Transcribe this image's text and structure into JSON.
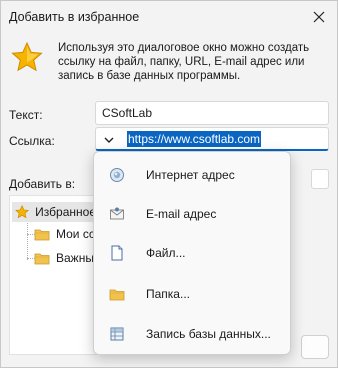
{
  "window": {
    "title": "Добавить в избранное"
  },
  "intro": {
    "text": "Используя это диалоговое окно можно создать ссылку на файл, папку, URL, E-mail адрес или запись в базе данных программы."
  },
  "form": {
    "text_label": "Текст:",
    "text_value": "CSoftLab",
    "link_label": "Ссылка:",
    "link_value": "https://www.csoftlab.com",
    "addto_label": "Добавить в:"
  },
  "tree": {
    "items": [
      {
        "label": "Избранное",
        "icon": "star-icon"
      },
      {
        "label": "Мои ссы",
        "icon": "folder-icon"
      },
      {
        "label": "Важные",
        "icon": "folder-icon"
      }
    ]
  },
  "dropdown": {
    "items": [
      {
        "label": "Интернет адрес",
        "icon": "globe-icon"
      },
      {
        "label": "E-mail адрес",
        "icon": "envelope-icon"
      },
      {
        "label": "Файл...",
        "icon": "file-icon"
      },
      {
        "label": "Папка...",
        "icon": "folder-icon"
      },
      {
        "label": "Запись базы данных...",
        "icon": "database-record-icon"
      }
    ]
  },
  "colors": {
    "accent": "#0a66c2",
    "star": "#f5b400",
    "folder": "#f2c24e"
  }
}
